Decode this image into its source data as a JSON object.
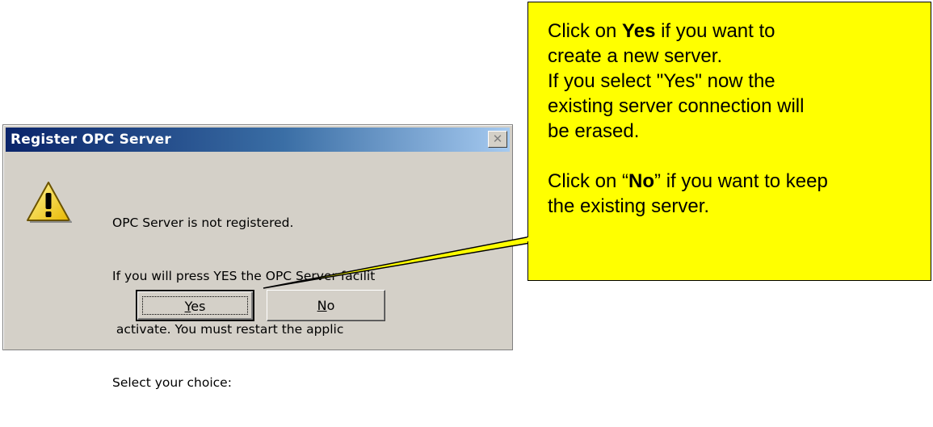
{
  "dialog": {
    "title": "Register OPC Server",
    "close_glyph": "✕",
    "icon": "warning-icon",
    "message_lines": [
      "OPC Server is not registered.",
      "If you will press YES the OPC Server facilit",
      " activate. You must restart the applic",
      "Select your choice:"
    ],
    "yes_prefix": "",
    "yes_underlined": "Y",
    "yes_rest": "es",
    "no_underlined": "N",
    "no_rest": "o"
  },
  "callout": {
    "line1_pre": "Click on ",
    "line1_bold": "Yes",
    "line1_post": " if you want to",
    "line2": "create a new server.",
    "line3": "If you select \"Yes\" now the",
    "line4": "existing server connection will",
    "line5": "be erased.",
    "line6_pre": "Click on “",
    "line6_bold": "No",
    "line6_post": "” if you want to keep",
    "line7": "the existing server.",
    "color": "#ffff00"
  }
}
